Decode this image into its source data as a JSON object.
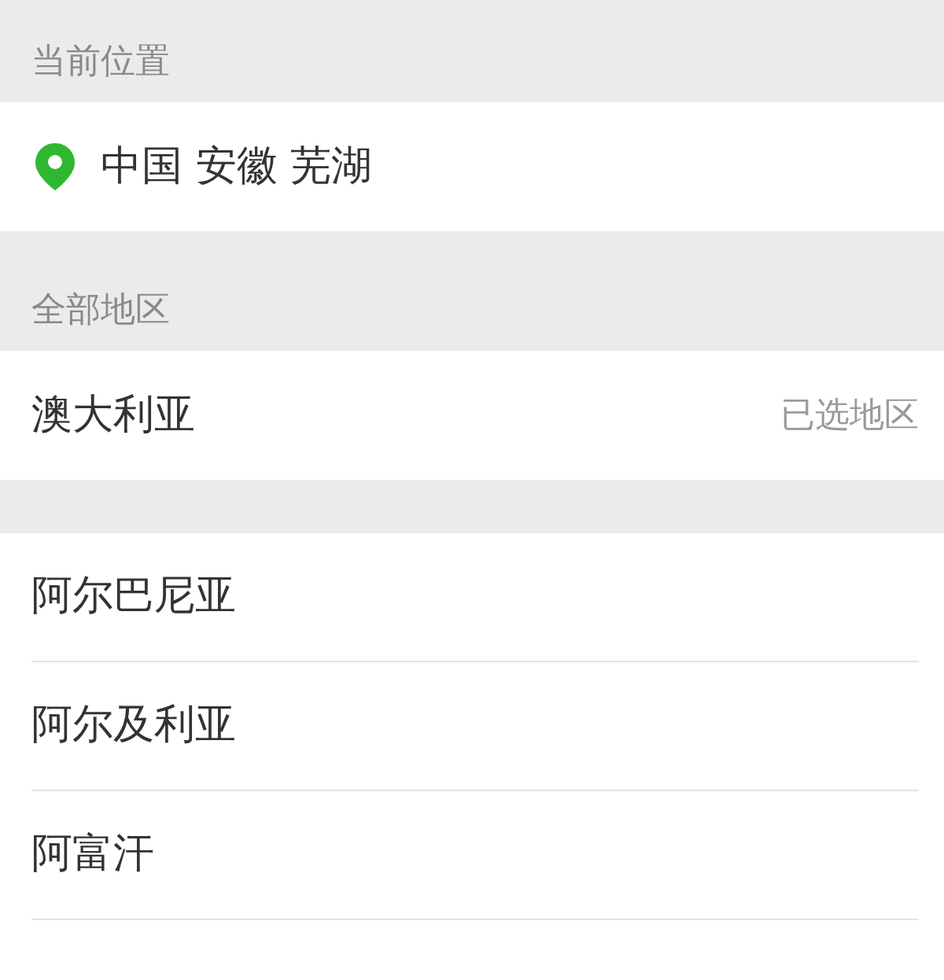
{
  "current_location": {
    "section_label": "当前位置",
    "name": "中国 安徽 芜湖"
  },
  "all_regions": {
    "section_label": "全部地区",
    "selected_region": {
      "name": "澳大利亚",
      "note": "已选地区"
    }
  },
  "regions": [
    {
      "name": "阿尔巴尼亚"
    },
    {
      "name": "阿尔及利亚"
    },
    {
      "name": "阿富汗"
    }
  ]
}
